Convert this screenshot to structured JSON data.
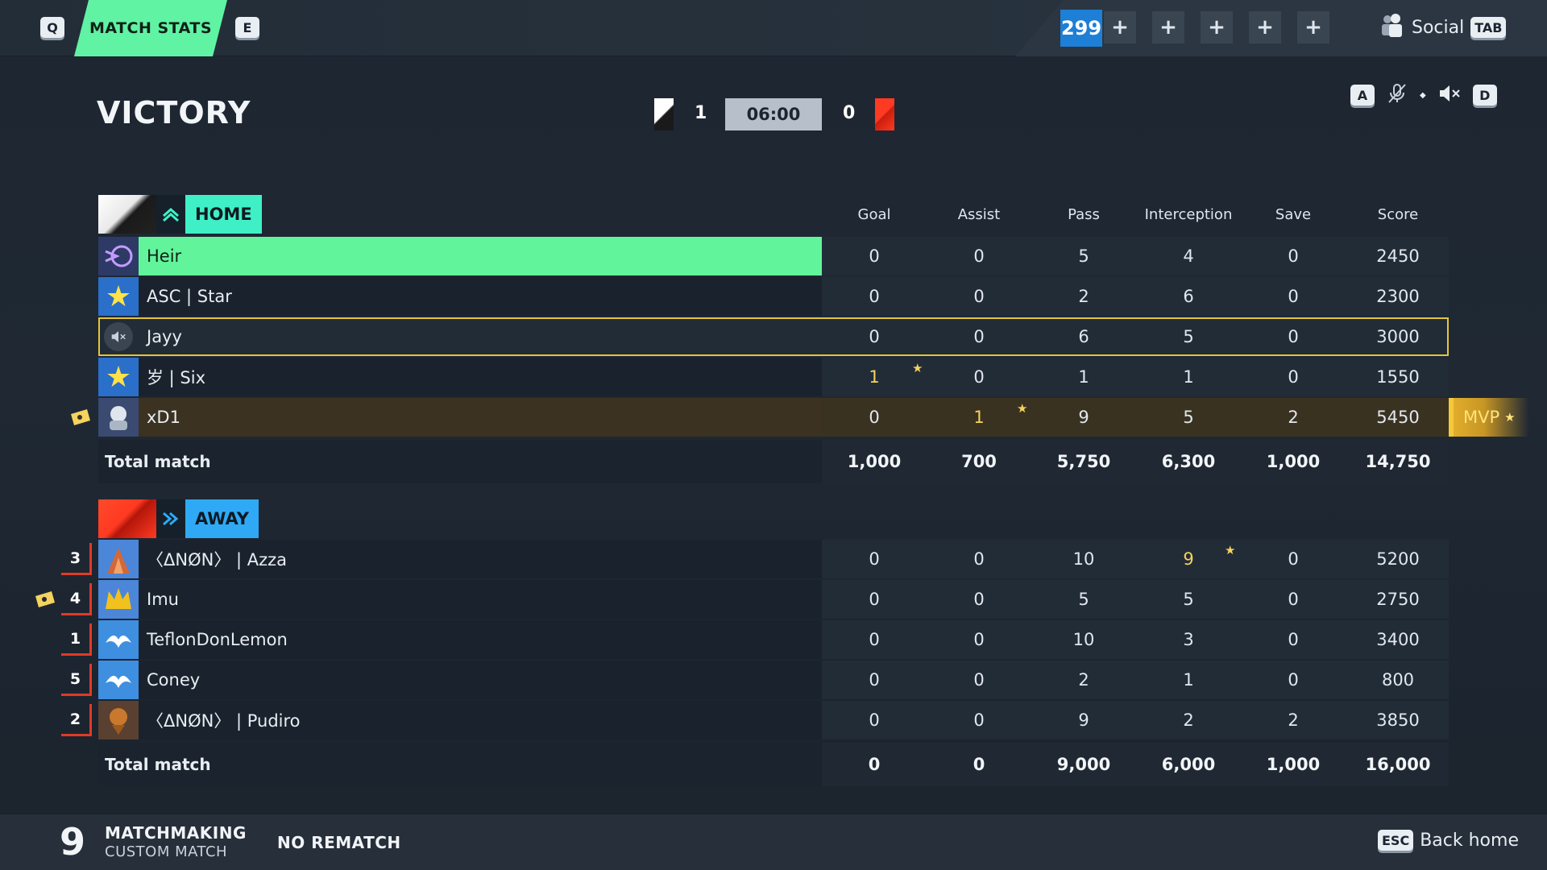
{
  "topbar": {
    "left_key": "Q",
    "tab_label": "MATCH STATS",
    "right_key": "E",
    "currency": "299",
    "plus_label": "+",
    "social_label": "Social",
    "social_key": "TAB"
  },
  "result": {
    "title": "VICTORY",
    "home_score": "1",
    "timer": "06:00",
    "away_score": "0"
  },
  "voice": {
    "left_key": "A",
    "right_key": "D"
  },
  "columns": [
    "Goal",
    "Assist",
    "Pass",
    "Interception",
    "Save",
    "Score"
  ],
  "home": {
    "team_name": "HOME",
    "players": [
      {
        "name": "Heir",
        "stats": [
          "0",
          "0",
          "5",
          "4",
          "0",
          "2450"
        ]
      },
      {
        "name": "ASC | Star",
        "stats": [
          "0",
          "0",
          "2",
          "6",
          "0",
          "2300"
        ]
      },
      {
        "name": "Jayy",
        "stats": [
          "0",
          "0",
          "6",
          "5",
          "0",
          "3000"
        ]
      },
      {
        "name": "岁 | Six",
        "stats": [
          "1",
          "0",
          "1",
          "1",
          "0",
          "1550"
        ]
      },
      {
        "name": "xD1",
        "stats": [
          "0",
          "1",
          "9",
          "5",
          "2",
          "5450"
        ]
      }
    ],
    "total_label": "Total match",
    "totals": [
      "1,000",
      "700",
      "5,750",
      "6,300",
      "1,000",
      "14,750"
    ],
    "mvp_label": "MVP"
  },
  "away": {
    "team_name": "AWAY",
    "players": [
      {
        "rank": "3",
        "name": "〈ΔNØN〉 | Azza",
        "stats": [
          "0",
          "0",
          "10",
          "9",
          "0",
          "5200"
        ]
      },
      {
        "rank": "4",
        "name": "Imu",
        "stats": [
          "0",
          "0",
          "5",
          "5",
          "0",
          "2750"
        ]
      },
      {
        "rank": "1",
        "name": "TeflonDonLemon",
        "stats": [
          "0",
          "0",
          "10",
          "3",
          "0",
          "3400"
        ]
      },
      {
        "rank": "5",
        "name": "Coney",
        "stats": [
          "0",
          "0",
          "2",
          "1",
          "0",
          "800"
        ]
      },
      {
        "rank": "2",
        "name": "〈ΔNØN〉 | Pudiro",
        "stats": [
          "0",
          "0",
          "9",
          "2",
          "2",
          "3850"
        ]
      }
    ],
    "total_label": "Total match",
    "totals": [
      "0",
      "0",
      "9,000",
      "6,000",
      "1,000",
      "16,000"
    ]
  },
  "bottom": {
    "count": "9",
    "mode": "MATCHMAKING",
    "submode": "CUSTOM MATCH",
    "rematch": "NO REMATCH",
    "back_key": "ESC",
    "back_label": "Back home"
  },
  "colors": {
    "accent_green": "#5ff3a3",
    "home_teal": "#3ff0c6",
    "away_blue": "#2fa9f5",
    "gold": "#f4d35e",
    "away_red": "#ff3a22"
  }
}
